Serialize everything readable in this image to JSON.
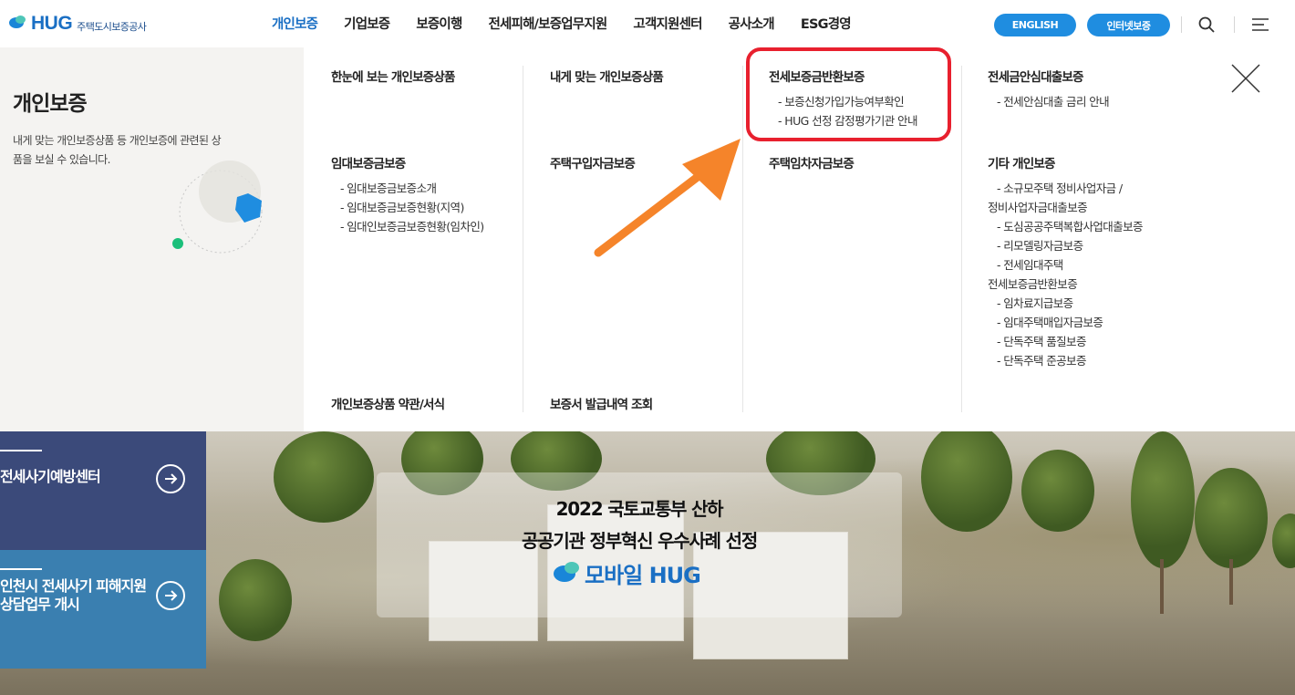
{
  "header": {
    "logo_text": "HUG",
    "logo_sub": "주택도시보증공사",
    "nav": [
      "개인보증",
      "기업보증",
      "보증이행",
      "전세피해/보증업무지원",
      "고객지원센터",
      "공사소개",
      "ESG경영"
    ],
    "btn_english": "ENGLISH",
    "btn_internet": "인터넷보증",
    "accent_color": "#1a6fc4"
  },
  "mega": {
    "title": "개인보증",
    "desc": "내게 맞는 개인보증상품 등 개인보증에 관련된 상품을 보실 수 있습니다.",
    "groups": {
      "g1": {
        "title": "한눈에 보는 개인보증상품"
      },
      "g2": {
        "title": "내게 맞는 개인보증상품"
      },
      "g3": {
        "title": "전세보증금반환보증",
        "items": [
          "-  보증신청가입가능여부확인",
          "-  HUG 선정 감정평가기관 안내"
        ]
      },
      "g4": {
        "title": "전세금안심대출보증",
        "items": [
          "-  전세안심대출 금리 안내"
        ]
      },
      "g5": {
        "title": "임대보증금보증",
        "items": [
          "-  임대보증금보증소개",
          "-  임대보증금보증현황(지역)",
          "-  임대인보증금보증현황(임차인)"
        ]
      },
      "g6": {
        "title": "주택구입자금보증"
      },
      "g7": {
        "title": "주택임차자금보증"
      },
      "g8": {
        "title": "기타 개인보증",
        "items": [
          "-  소규모주택 정비사업자금 /",
          "정비사업자금대출보증",
          "-  도심공공주택복합사업대출보증",
          "-  리모델링자금보증",
          "-  전세임대주택",
          "전세보증금반환보증",
          "-  임차료지급보증",
          "-  임대주택매입자금보증",
          "-  단독주택 품질보증",
          "-  단독주택 준공보증"
        ]
      },
      "g9": {
        "title": "개인보증상품 약관/서식"
      },
      "g10": {
        "title": "보증서 발급내역 조회"
      }
    },
    "highlight_color": "#e8202e",
    "arrow_color": "#f5842a"
  },
  "hero": {
    "notice1": "전세사기예방센터",
    "notice2_line1": "인천시 전세사기 피해지원",
    "notice2_line2": "상담업무 개시",
    "banner_line1": "2022 국토교통부 산하",
    "banner_line2": "공공기관 정부혁신 우수사례 선정",
    "banner_logo": "모바일 HUG"
  }
}
